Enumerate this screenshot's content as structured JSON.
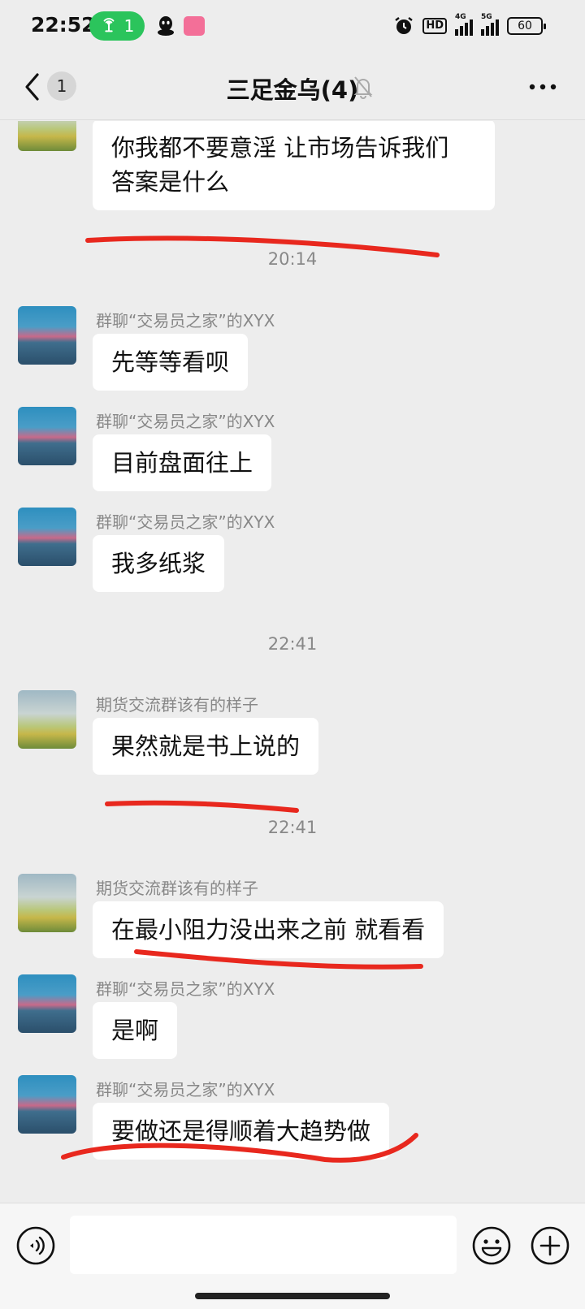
{
  "status_bar": {
    "time": "22:52",
    "hotspot_count": "1",
    "hd_label": "HD",
    "network_1": "4G",
    "network_2": "5G",
    "battery": "60"
  },
  "nav": {
    "unread_badge": "1",
    "title": "三足金乌(4)"
  },
  "messages": [
    {
      "sender": "",
      "text_lines": [
        "你我都不要意淫 让市场告诉我们",
        "答案是什么"
      ],
      "avatar": "field"
    },
    {
      "timestamp": "20:14"
    },
    {
      "sender": "群聊“交易员之家”的XYX",
      "text": "先等等看呗",
      "avatar": "sunset"
    },
    {
      "sender": "群聊“交易员之家”的XYX",
      "text": "目前盘面往上",
      "avatar": "sunset"
    },
    {
      "sender": "群聊“交易员之家”的XYX",
      "text": "我多纸浆",
      "avatar": "sunset"
    },
    {
      "timestamp": "22:41"
    },
    {
      "sender": "期货交流群该有的样子",
      "text": "果然就是书上说的",
      "avatar": "field"
    },
    {
      "timestamp": "22:41"
    },
    {
      "sender": "期货交流群该有的样子",
      "text": "在最小阻力没出来之前 就看看",
      "avatar": "field"
    },
    {
      "sender": "群聊“交易员之家”的XYX",
      "text": "是啊",
      "avatar": "sunset"
    },
    {
      "sender": "群聊“交易员之家”的XYX",
      "text": "要做还是得顺着大趋势做",
      "avatar": "sunset"
    }
  ],
  "input_bar": {
    "placeholder": ""
  },
  "annotation_color": "#e8281e"
}
